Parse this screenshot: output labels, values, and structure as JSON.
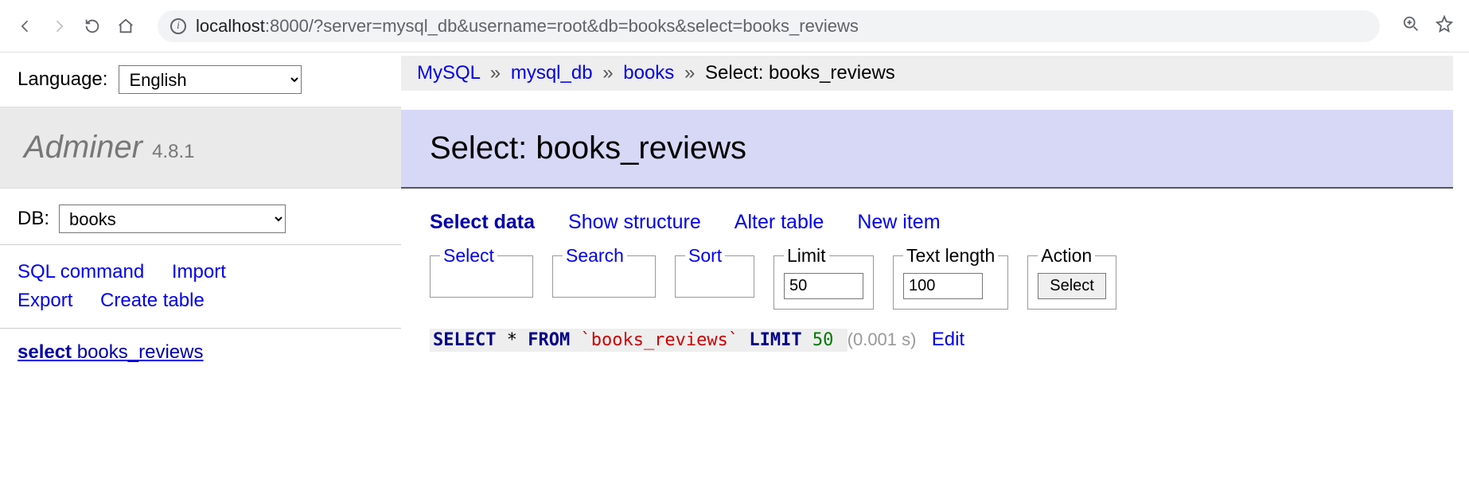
{
  "browser": {
    "url_prefix": "localhost",
    "url_port": ":8000",
    "url_path": "/?server=mysql_db&username=root&db=books&select=books_reviews"
  },
  "sidebar": {
    "language_label": "Language:",
    "language_value": "English",
    "app_name": "Adminer",
    "app_version": "4.8.1",
    "db_label": "DB:",
    "db_value": "books",
    "links": {
      "sql_command": "SQL command",
      "import": "Import",
      "export": "Export",
      "create_table": "Create table"
    },
    "table_select_kw": "select",
    "table_name": "books_reviews"
  },
  "breadcrumb": {
    "driver": "MySQL",
    "server": "mysql_db",
    "database": "books",
    "current": "Select: books_reviews",
    "sep": "»"
  },
  "page_title": "Select: books_reviews",
  "tabs": {
    "select_data": "Select data",
    "show_structure": "Show structure",
    "alter_table": "Alter table",
    "new_item": "New item"
  },
  "fieldsets": {
    "select": "Select",
    "search": "Search",
    "sort": "Sort",
    "limit_label": "Limit",
    "limit_value": "50",
    "textlength_label": "Text length",
    "textlength_value": "100",
    "action_label": "Action",
    "action_button": "Select"
  },
  "sql": {
    "kw_select": "SELECT",
    "star": "*",
    "kw_from": "FROM",
    "table": "`books_reviews`",
    "kw_limit": "LIMIT",
    "limit_num": "50",
    "timing": "(0.001 s)",
    "edit": "Edit"
  }
}
